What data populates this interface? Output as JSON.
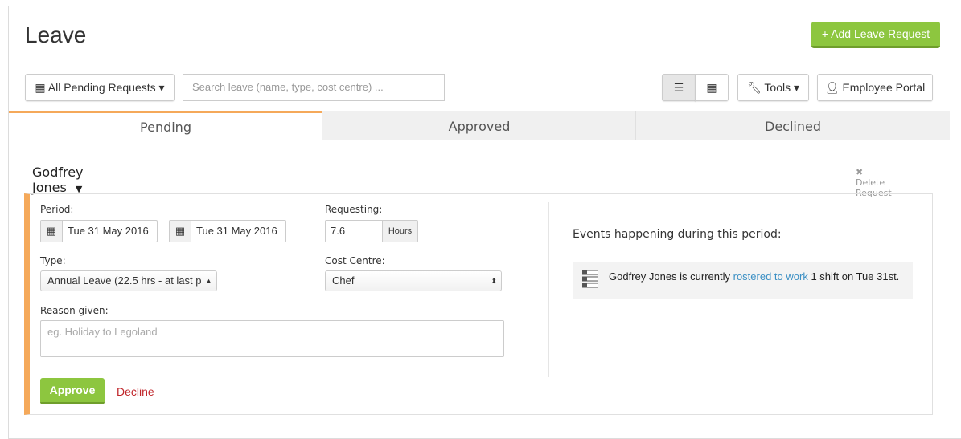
{
  "header": {
    "title": "Leave",
    "add_button": "+ Add Leave Request"
  },
  "toolbar": {
    "filter_label": "All Pending Requests",
    "search_placeholder": "Search leave (name, type, cost centre) ...",
    "tools_label": "Tools",
    "portal_label": "Employee Portal"
  },
  "tabs": [
    {
      "label": "Pending"
    },
    {
      "label": "Approved"
    },
    {
      "label": "Declined"
    }
  ],
  "request": {
    "person": "Godfrey Jones",
    "delete_label": "Delete Request",
    "period_label": "Period:",
    "start_date": "Tue 31 May 2016",
    "end_date": "Tue 31 May 2016",
    "requesting_label": "Requesting:",
    "requesting_value": "7.6",
    "requesting_unit": "Hours",
    "type_label": "Type:",
    "type_value": "Annual Leave (22.5 hrs - at last p",
    "cost_centre_label": "Cost Centre:",
    "cost_centre_value": "Chef",
    "reason_label": "Reason given:",
    "reason_placeholder": "eg. Holiday to Legoland",
    "approve_label": "Approve",
    "decline_label": "Decline"
  },
  "events": {
    "title": "Events happening during this period:",
    "prefix": "Godfrey Jones is currently ",
    "link": "rostered to work",
    "suffix": " 1 shift on Tue 31st."
  },
  "colors": {
    "accent_green": "#8dc63f",
    "accent_orange": "#f5a95a",
    "decline_red": "#c0262b",
    "link_blue": "#3a8fc4"
  }
}
